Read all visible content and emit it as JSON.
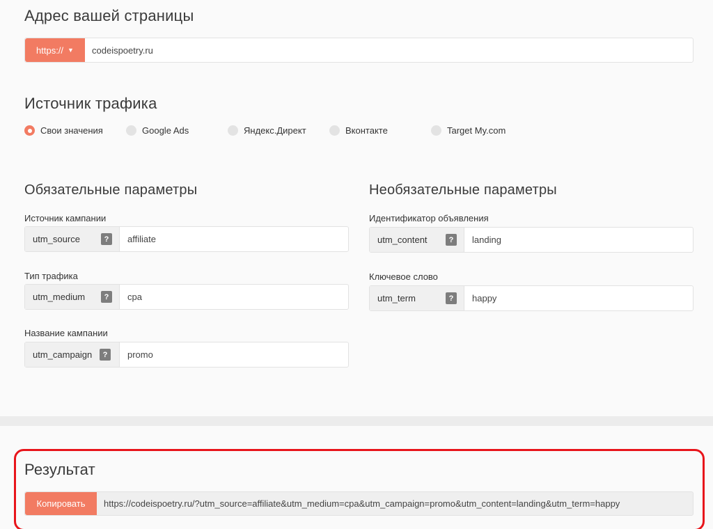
{
  "page_url": {
    "heading": "Адрес вашей страницы",
    "protocol": "https://",
    "value": "codeispoetry.ru"
  },
  "traffic": {
    "heading": "Источник трафика",
    "options": [
      {
        "label": "Свои значения",
        "checked": true
      },
      {
        "label": "Google Ads",
        "checked": false
      },
      {
        "label": "Яндекс.Директ",
        "checked": false
      },
      {
        "label": "Вконтакте",
        "checked": false
      },
      {
        "label": "Target My.com",
        "checked": false
      }
    ]
  },
  "required": {
    "heading": "Обязательные параметры",
    "fields": [
      {
        "label": "Источник кампании",
        "param": "utm_source",
        "value": "affiliate"
      },
      {
        "label": "Тип трафика",
        "param": "utm_medium",
        "value": "cpa"
      },
      {
        "label": "Название кампании",
        "param": "utm_campaign",
        "value": "promo"
      }
    ]
  },
  "optional": {
    "heading": "Необязательные параметры",
    "fields": [
      {
        "label": "Идентификатор объявления",
        "param": "utm_content",
        "value": "landing"
      },
      {
        "label": "Ключевое слово",
        "param": "utm_term",
        "value": "happy"
      }
    ]
  },
  "help_glyph": "?",
  "result": {
    "heading": "Результат",
    "copy_label": "Копировать",
    "url": "https://codeispoetry.ru/?utm_source=affiliate&utm_medium=cpa&utm_campaign=promo&utm_content=landing&utm_term=happy"
  },
  "colors": {
    "accent": "#f27b62",
    "highlight_border": "#e8151b"
  }
}
